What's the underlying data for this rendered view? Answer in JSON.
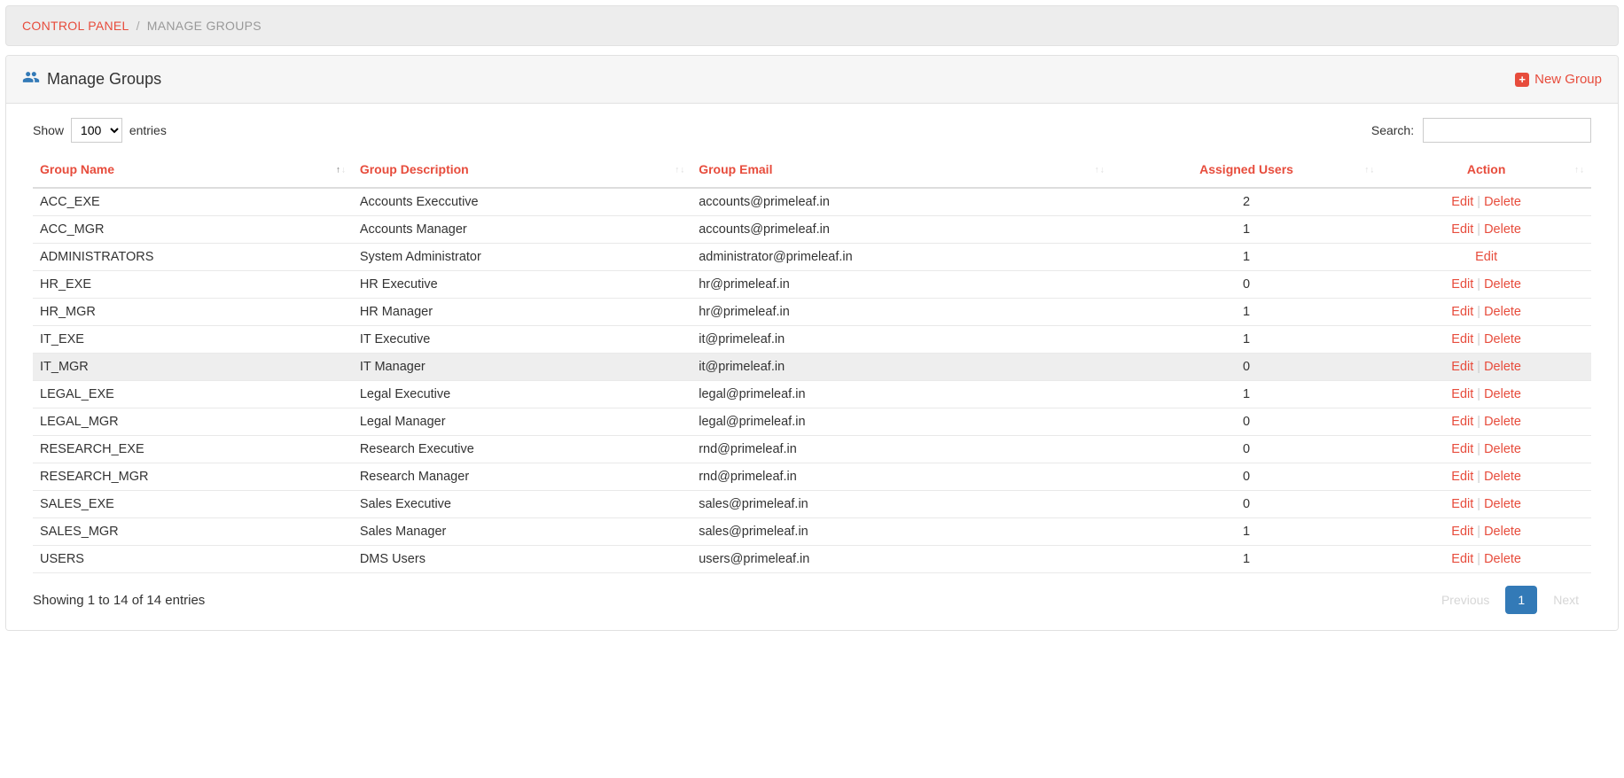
{
  "breadcrumb": {
    "parent": "CONTROL PANEL",
    "current": "MANAGE GROUPS"
  },
  "panel": {
    "title": "Manage Groups",
    "new_group_label": "New Group"
  },
  "length_control": {
    "prefix": "Show",
    "suffix": "entries",
    "selected": "100"
  },
  "search": {
    "label": "Search:",
    "value": ""
  },
  "columns": [
    {
      "label": "Group Name",
      "sortable": true,
      "align": "left",
      "sorted": "asc"
    },
    {
      "label": "Group Description",
      "sortable": true,
      "align": "left"
    },
    {
      "label": "Group Email",
      "sortable": true,
      "align": "left"
    },
    {
      "label": "Assigned Users",
      "sortable": true,
      "align": "center"
    },
    {
      "label": "Action",
      "sortable": true,
      "align": "center"
    }
  ],
  "action_labels": {
    "edit": "Edit",
    "delete": "Delete"
  },
  "rows": [
    {
      "name": "ACC_EXE",
      "description": "Accounts Execcutive",
      "email": "accounts@primeleaf.in",
      "users": "2",
      "can_delete": true,
      "highlight": false
    },
    {
      "name": "ACC_MGR",
      "description": "Accounts Manager",
      "email": "accounts@primeleaf.in",
      "users": "1",
      "can_delete": true,
      "highlight": false
    },
    {
      "name": "ADMINISTRATORS",
      "description": "System Administrator",
      "email": "administrator@primeleaf.in",
      "users": "1",
      "can_delete": false,
      "highlight": false
    },
    {
      "name": "HR_EXE",
      "description": "HR Executive",
      "email": "hr@primeleaf.in",
      "users": "0",
      "can_delete": true,
      "highlight": false
    },
    {
      "name": "HR_MGR",
      "description": "HR Manager",
      "email": "hr@primeleaf.in",
      "users": "1",
      "can_delete": true,
      "highlight": false
    },
    {
      "name": "IT_EXE",
      "description": "IT Executive",
      "email": "it@primeleaf.in",
      "users": "1",
      "can_delete": true,
      "highlight": false
    },
    {
      "name": "IT_MGR",
      "description": "IT Manager",
      "email": "it@primeleaf.in",
      "users": "0",
      "can_delete": true,
      "highlight": true
    },
    {
      "name": "LEGAL_EXE",
      "description": "Legal Executive",
      "email": "legal@primeleaf.in",
      "users": "1",
      "can_delete": true,
      "highlight": false
    },
    {
      "name": "LEGAL_MGR",
      "description": "Legal Manager",
      "email": "legal@primeleaf.in",
      "users": "0",
      "can_delete": true,
      "highlight": false
    },
    {
      "name": "RESEARCH_EXE",
      "description": "Research Executive",
      "email": "rnd@primeleaf.in",
      "users": "0",
      "can_delete": true,
      "highlight": false
    },
    {
      "name": "RESEARCH_MGR",
      "description": "Research Manager",
      "email": "rnd@primeleaf.in",
      "users": "0",
      "can_delete": true,
      "highlight": false
    },
    {
      "name": "SALES_EXE",
      "description": "Sales Executive",
      "email": "sales@primeleaf.in",
      "users": "0",
      "can_delete": true,
      "highlight": false
    },
    {
      "name": "SALES_MGR",
      "description": "Sales Manager",
      "email": "sales@primeleaf.in",
      "users": "1",
      "can_delete": true,
      "highlight": false
    },
    {
      "name": "USERS",
      "description": "DMS Users",
      "email": "users@primeleaf.in",
      "users": "1",
      "can_delete": true,
      "highlight": false
    }
  ],
  "footer": {
    "info": "Showing 1 to 14 of 14 entries"
  },
  "pagination": {
    "previous": "Previous",
    "next": "Next",
    "current_page": "1"
  }
}
